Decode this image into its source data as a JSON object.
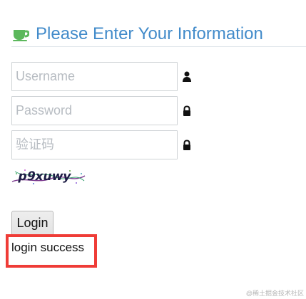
{
  "header": {
    "title": "Please Enter Your Information",
    "icon": "coffee-cup-icon"
  },
  "form": {
    "username": {
      "placeholder": "Username",
      "value": "",
      "icon": "user-icon"
    },
    "password": {
      "placeholder": "Password",
      "value": "",
      "icon": "lock-icon"
    },
    "captcha_input": {
      "placeholder": "验证码",
      "value": "",
      "icon": "lock-icon"
    },
    "captcha_text": "p9xuwy",
    "login_label": "Login"
  },
  "result": {
    "message": "login success",
    "highlight_color": "#ef3c37"
  },
  "watermark": "@稀土掘金技术社区",
  "colors": {
    "title": "#428bca",
    "icon_green": "#5cb85c"
  }
}
